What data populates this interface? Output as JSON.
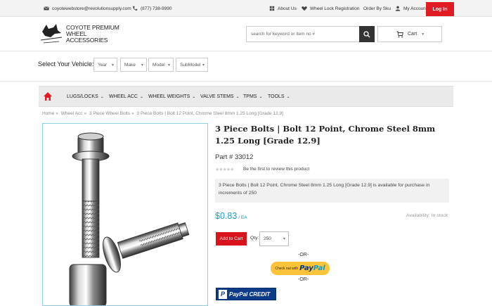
{
  "topbar": {
    "email": "coyotewebstore@revolutionsupply.com",
    "phone": "(877) 738-9990",
    "about": "About Us",
    "wheel_lock": "Wheel Lock Registration",
    "order_sku": "Order By Sku",
    "my_account": "My Account",
    "login": "Log In"
  },
  "header": {
    "logo_script": "Coyote",
    "logo_line1": "COYOTE PREMIUM WHEEL",
    "logo_line2": "ACCESSORIES",
    "search_placeholder": "search for keyword or item no #",
    "cart_label": "Cart"
  },
  "vehicle": {
    "label": "Select Your Vehicle:",
    "selects": [
      "Year",
      "Make",
      "Model",
      "SubModel"
    ]
  },
  "nav": {
    "items": [
      "LUGS/LOCKS",
      "WHEEL ACC",
      "WHEEL WEIGHTS",
      "VALVE STEMS",
      "TPMS",
      "TOOLS"
    ]
  },
  "breadcrumb": [
    "Home",
    "Wheel Acc",
    "3 Piece Wheel Bolts",
    "3 Piece Bolts | Bolt 12 Point, Chrome Steel 8mm 1.25 Long [Grade 12.9]"
  ],
  "product": {
    "title": "3 Piece Bolts | Bolt 12 Point, Chrome Steel 8mm 1.25 Long [Grade 12.9]",
    "part_no": "Part # 33012",
    "review_text": "Be the first to review this product",
    "description": "3 Piece Bolts | Bolt 12 Point, Chrome Steel 8mm 1.25 Long [Grade 12.9] is available for purchase in increments of 250",
    "price": "$0.83",
    "price_unit": "/ EA",
    "availability": "Availability: In stock",
    "add_to_cart": "Add to Cart",
    "qty_label": "Qty:",
    "qty_value": "250",
    "or_text": "-OR-",
    "paypal_checkout_small": "Check out with",
    "paypal_word1": "Pay",
    "paypal_word2": "Pal",
    "paypal_credit": "PayPal CREDIT",
    "rating": 0
  },
  "colors": {
    "accent_red": "#e11b22",
    "price_blue": "#1fa0c8",
    "paypal_yellow": "#ffc439",
    "paypal_navy": "#0e3a8a"
  }
}
